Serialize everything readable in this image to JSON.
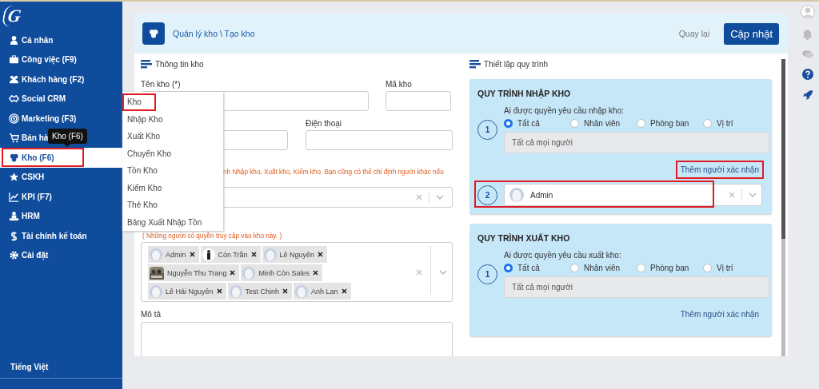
{
  "sidebar": {
    "logo": "G",
    "items": [
      {
        "label": "Cá nhân",
        "selected": false,
        "highlighted": false
      },
      {
        "label": "Công việc (F9)",
        "selected": false,
        "highlighted": false
      },
      {
        "label": "Khách hàng (F2)",
        "selected": false,
        "highlighted": false
      },
      {
        "label": "Social CRM",
        "selected": false,
        "highlighted": false
      },
      {
        "label": "Marketing (F3)",
        "selected": false,
        "highlighted": false
      },
      {
        "label": "Bán hà",
        "selected": false,
        "highlighted": false
      },
      {
        "label": "Kho (F6)",
        "selected": true,
        "highlighted": true
      },
      {
        "label": "CSKH",
        "selected": false,
        "highlighted": false
      },
      {
        "label": "KPI (F7)",
        "selected": false,
        "highlighted": false
      },
      {
        "label": "HRM",
        "selected": false,
        "highlighted": false
      },
      {
        "label": "Tài chính kế toán",
        "selected": false,
        "highlighted": false
      },
      {
        "label": "Cài đặt",
        "selected": false,
        "highlighted": false
      }
    ],
    "language": "Tiếng Việt"
  },
  "tooltip": "Kho (F6)",
  "submenu": [
    {
      "label": "Kho",
      "highlighted": true
    },
    {
      "label": "Nhập Kho",
      "highlighted": false
    },
    {
      "label": "Xuất Kho",
      "highlighted": false
    },
    {
      "label": "Chuyển Kho",
      "highlighted": false
    },
    {
      "label": "Tồn Kho",
      "highlighted": false
    },
    {
      "label": "Kiểm Kho",
      "highlighted": false
    },
    {
      "label": "Thẻ Kho",
      "highlighted": false
    },
    {
      "label": "Bảng Xuất Nhập Tồn",
      "highlighted": false
    }
  ],
  "header": {
    "breadcrumb": "Quản lý kho \\ Tạo kho",
    "back": "Quay lại",
    "submit": "Cập nhật"
  },
  "info": {
    "heading": "Thông tin kho",
    "name_label": "Tên kho (*)",
    "code_label": "Mã kho",
    "phone_label": "Điện thoại",
    "manager_note": "nh Nhập kho, Xuất kho, Kiểm kho. Bạn cũng có thể chỉ định người khác nếu",
    "access_note": "( Những người có quyền truy cập vào kho này. )",
    "members": [
      {
        "name": "Admin",
        "kind": "blank"
      },
      {
        "name": "Còn Trần",
        "kind": "figure"
      },
      {
        "name": "Lê Nguyên",
        "kind": "blank"
      },
      {
        "name": "Nguyễn Thu Trang"
      },
      {
        "name": "Minh Còn Sales",
        "kind": "blank"
      },
      {
        "name": "Lê Hải Nguyên",
        "kind": "blank"
      },
      {
        "name": "Test Chinh",
        "kind": "blank"
      },
      {
        "name": "Anh Lan",
        "kind": "blank"
      }
    ],
    "description_label": "Mô tả"
  },
  "process": {
    "heading": "Thiết lập quy trình",
    "cards": [
      {
        "title": "QUY TRÌNH NHẬP KHO",
        "question": "Ai được quyền yêu cầu nhập kho:",
        "step": "1",
        "options": [
          {
            "label": "Tất cả",
            "selected": true
          },
          {
            "label": "Nhân viên",
            "selected": false
          },
          {
            "label": "Phòng ban",
            "selected": false
          },
          {
            "label": "Vị trí",
            "selected": false
          }
        ],
        "scope": "Tất cả mọi người",
        "add_link": "Thêm người xác nhận",
        "link_highlighted": true,
        "approver": {
          "step": "2",
          "name": "Admin",
          "highlighted": true
        }
      },
      {
        "title": "QUY TRÌNH XUẤT KHO",
        "question": "Ai được quyền yêu cầu xuất kho:",
        "step": "1",
        "options": [
          {
            "label": "Tất cả",
            "selected": true
          },
          {
            "label": "Nhân viên",
            "selected": false
          },
          {
            "label": "Phòng ban",
            "selected": false
          },
          {
            "label": "Vị trí",
            "selected": false
          }
        ],
        "scope": "Tất cả mọi người",
        "add_link": "Thêm người xác nhận",
        "link_highlighted": false
      }
    ]
  }
}
